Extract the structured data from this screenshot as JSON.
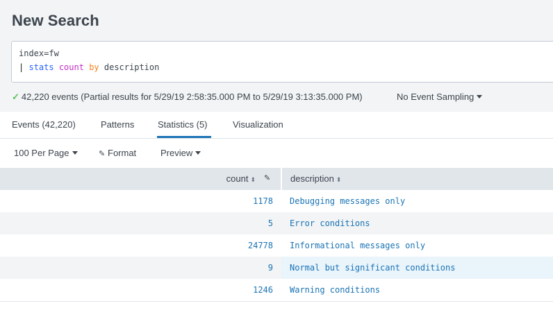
{
  "page": {
    "title": "New Search"
  },
  "search": {
    "line1": "index=fw",
    "line2": {
      "pipe": "|",
      "cmd": "stats",
      "fn": "count",
      "by": "by",
      "field": "description"
    }
  },
  "status": {
    "check": "✓",
    "text": "42,220 events (Partial results for 5/29/19 2:58:35.000 PM to 5/29/19 3:13:35.000 PM)",
    "sampling": "No Event Sampling"
  },
  "tabs": [
    {
      "label": "Events (42,220)"
    },
    {
      "label": "Patterns"
    },
    {
      "label": "Statistics (5)",
      "active": true
    },
    {
      "label": "Visualization"
    }
  ],
  "toolbar": {
    "per_page": "100 Per Page",
    "format": "Format",
    "preview": "Preview"
  },
  "table": {
    "columns": [
      "count",
      "description"
    ],
    "rows": [
      {
        "count": "1178",
        "description": "Debugging messages only"
      },
      {
        "count": "5",
        "description": "Error conditions"
      },
      {
        "count": "24778",
        "description": "Informational messages only"
      },
      {
        "count": "9",
        "description": "Normal but significant conditions"
      },
      {
        "count": "1246",
        "description": "Warning conditions"
      }
    ]
  },
  "colors": {
    "accent": "#1a73b4",
    "success": "#5cc05c",
    "header_bg": "#e1e6eb",
    "top_bg": "#f2f4f5"
  }
}
